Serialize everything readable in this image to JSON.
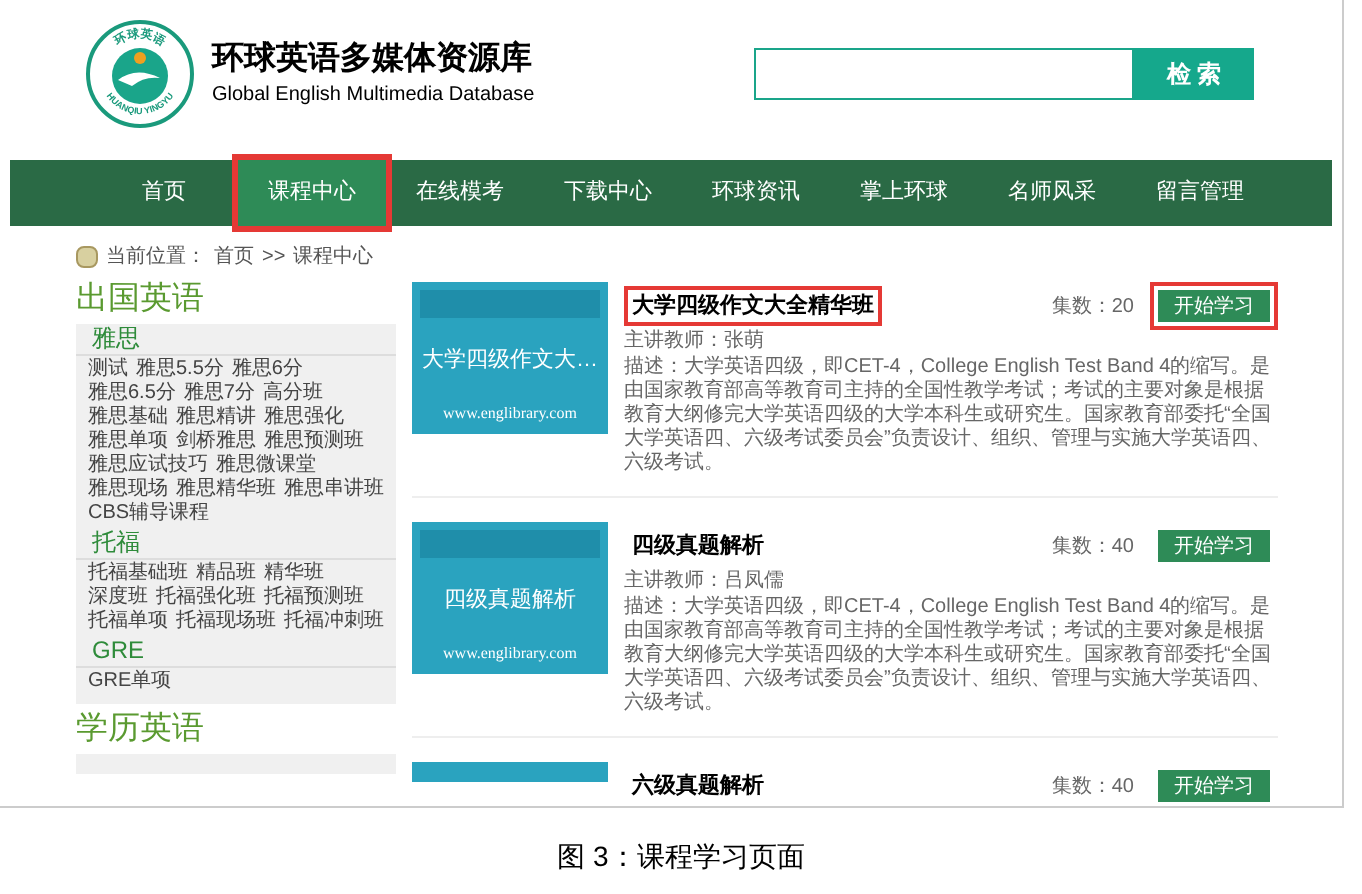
{
  "header": {
    "logo": {
      "top_text": "环球英语",
      "bottom_text": "HUANQIU YINGYU"
    },
    "title": "环球英语多媒体资源库",
    "subtitle": "Global English Multimedia Database",
    "search": {
      "button": "检 索"
    }
  },
  "nav": [
    {
      "label": "首页",
      "selected": false,
      "highlighted": false
    },
    {
      "label": "课程中心",
      "selected": true,
      "highlighted": true
    },
    {
      "label": "在线模考",
      "selected": false,
      "highlighted": false
    },
    {
      "label": "下载中心",
      "selected": false,
      "highlighted": false
    },
    {
      "label": "环球资讯",
      "selected": false,
      "highlighted": false
    },
    {
      "label": "掌上环球",
      "selected": false,
      "highlighted": false
    },
    {
      "label": "名师风采",
      "selected": false,
      "highlighted": false
    },
    {
      "label": "留言管理",
      "selected": false,
      "highlighted": false
    }
  ],
  "breadcrumb": {
    "label": "当前位置：",
    "items": [
      "首页",
      ">>",
      "课程中心"
    ]
  },
  "sidebar": [
    {
      "heading": "出国英语",
      "groups": [
        {
          "title": "雅思",
          "links": [
            "测试",
            "雅思5.5分",
            "雅思6分",
            "雅思6.5分",
            "雅思7分",
            "高分班",
            "雅思基础",
            "雅思精讲",
            "雅思强化",
            "雅思单项",
            "剑桥雅思",
            "雅思预测班",
            "雅思应试技巧",
            "雅思微课堂",
            "雅思现场",
            "雅思精华班",
            "雅思串讲班",
            "CBS辅导课程"
          ]
        },
        {
          "title": "托福",
          "links": [
            "托福基础班",
            "精品班",
            "精华班",
            "深度班",
            "托福强化班",
            "托福预测班",
            "托福单项",
            "托福现场班",
            "托福冲刺班"
          ]
        },
        {
          "title": "GRE",
          "links": [
            "GRE单项"
          ]
        }
      ]
    },
    {
      "heading": "学历英语"
    }
  ],
  "courses": [
    {
      "image_text": "大学四级作文大…",
      "image_url": "www.englibrary.com",
      "title": "大学四级作文大全精华班",
      "title_highlighted": true,
      "count": "集数：20",
      "button": "开始学习",
      "button_highlighted": true,
      "teacher": "主讲教师：张萌",
      "description": "描述：大学英语四级，即CET-4，College English Test Band 4的缩写。是由国家教育部高等教育司主持的全国性教学考试；考试的主要对象是根据教育大纲修完大学英语四级的大学本科生或研究生。国家教育部委托“全国大学英语四、六级考试委员会”负责设计、组织、管理与实施大学英语四、六级考试。"
    },
    {
      "image_text": "四级真题解析",
      "image_url": "www.englibrary.com",
      "title": "四级真题解析",
      "title_highlighted": false,
      "count": "集数：40",
      "button": "开始学习",
      "button_highlighted": false,
      "teacher": "主讲教师：吕凤儒",
      "description": "描述：大学英语四级，即CET-4，College English Test Band 4的缩写。是由国家教育部高等教育司主持的全国性教学考试；考试的主要对象是根据教育大纲修完大学英语四级的大学本科生或研究生。国家教育部委托“全国大学英语四、六级考试委员会”负责设计、组织、管理与实施大学英语四、六级考试。"
    },
    {
      "title": "六级真题解析",
      "title_highlighted": false,
      "count": "集数：40",
      "button": "开始学习",
      "button_highlighted": false
    }
  ],
  "caption": "图 3：课程学习页面"
}
